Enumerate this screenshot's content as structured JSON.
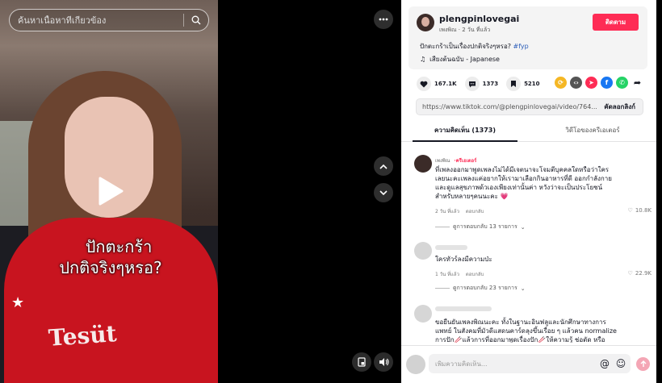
{
  "search": {
    "placeholder": "ค้นหาเนื้อหาที่เกี่ยวข้อง"
  },
  "video": {
    "caption_line1": "ปักตะกร้า",
    "caption_line2": "ปกติจริงๆหรอ?",
    "shirt_text": "Tesüt"
  },
  "author": {
    "username": "plengpinlovegai",
    "display_name": "เพงพิณ",
    "time_ago": "2 วัน ที่แล้ว",
    "follow_label": "ติดตาม"
  },
  "post": {
    "description": "ปักตะกร้าเป็นเรื่องปกติจริงๆหรอ?",
    "hashtag": "#fyp",
    "music": "เสียงต้นฉบับ - Japanese"
  },
  "stats": {
    "likes": "167.1K",
    "comments": "1373",
    "saves": "5210"
  },
  "share_icons": [
    {
      "name": "repost-icon",
      "color": "#f5b724",
      "glyph": "⟳"
    },
    {
      "name": "embed-icon",
      "color": "#555555",
      "glyph": "‹›"
    },
    {
      "name": "send-icon",
      "color": "#fe2c55",
      "glyph": "➤"
    },
    {
      "name": "facebook-icon",
      "color": "#1877f2",
      "glyph": "f"
    },
    {
      "name": "whatsapp-icon",
      "color": "#25d366",
      "glyph": "✆"
    },
    {
      "name": "share-arrow-icon",
      "color": "#ffffff",
      "glyph": "➦"
    }
  ],
  "link": {
    "url": "https://www.tiktok.com/@plengpinlovegai/video/764...",
    "copy_label": "คัดลอกลิงก์"
  },
  "tabs": [
    {
      "label": "ความคิดเห็น (1373)",
      "active": true
    },
    {
      "label": "วิดีโอของครีเอเตอร์",
      "active": false
    }
  ],
  "comments": [
    {
      "name": "เพงพิณ",
      "badge": "ครีเอเตอร์",
      "text": "ที่เพลงออกมาพูดเพลงไม่ได้มีเจตนาจะโจมตีบุคคลใดหรือว่าใคร เลยนะคะเพลงแค่อยากให้เรามาเลือกกินอาหารที่ดี ออกกำลังกายและดูแลสุขภาพด้วเองเพียงเท่านั้นค่า หวังว่าจะเป็นประโยชน์สำหรับหลายๆคนนะคะ 💗",
      "time": "2 วัน ที่แล้ว",
      "reply": "ตอบกลับ",
      "likes": "10.8K",
      "replies": "ดูการตอบกลับ 13 รายการ"
    },
    {
      "text": "ใครทัวร์ลงมีความป่ะ",
      "time": "1 วัน ที่แล้ว",
      "reply": "ตอบกลับ",
      "likes": "22.9K",
      "replies": "ดูการตอบกลับ 23 รายการ"
    },
    {
      "text": "ขอยืนยันเพลงพิณนะคะ ทั้งในฐานะอินฟลูและนักศึกษาทางการแพทย์ ในสังคมที่มัวดีแสดนคาร์ดลุงขึ้นเรื่อย ๆ แล้วคน normalize การปัก🥢แล้วการที่ออกมาพูดเรื่องปัก🥢ให้ความรู้ ช่อตัด หรือเตือน"
    }
  ],
  "comment_input": {
    "placeholder": "เพิ่มความคิดเห็น..."
  }
}
